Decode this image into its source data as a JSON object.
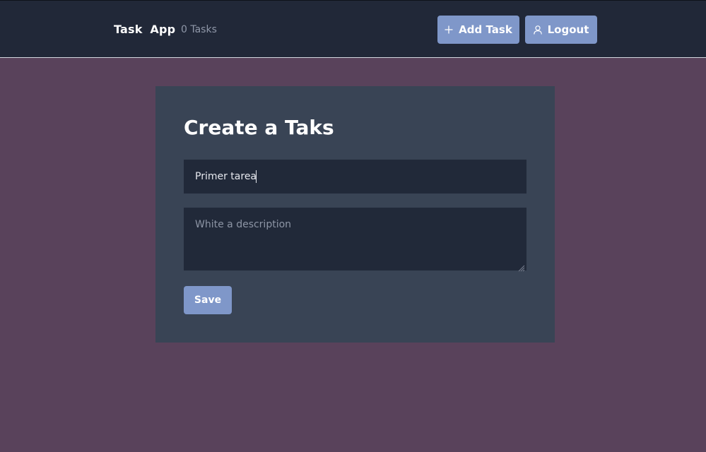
{
  "navbar": {
    "brand": "Task App",
    "task_count": "0 Tasks",
    "add_task_label": "Add Task",
    "add_task_icon": "plus-icon",
    "logout_label": "Logout",
    "logout_icon": "user-icon"
  },
  "form": {
    "title": "Create a Taks",
    "title_input_value": "Primer tarea",
    "description_placeholder": "White a description",
    "description_value": "",
    "save_label": "Save"
  },
  "colors": {
    "page_background": "#59425b",
    "navbar_background": "#212838",
    "card_background": "#394455",
    "input_background": "#212939",
    "accent": "#7f97c9"
  }
}
